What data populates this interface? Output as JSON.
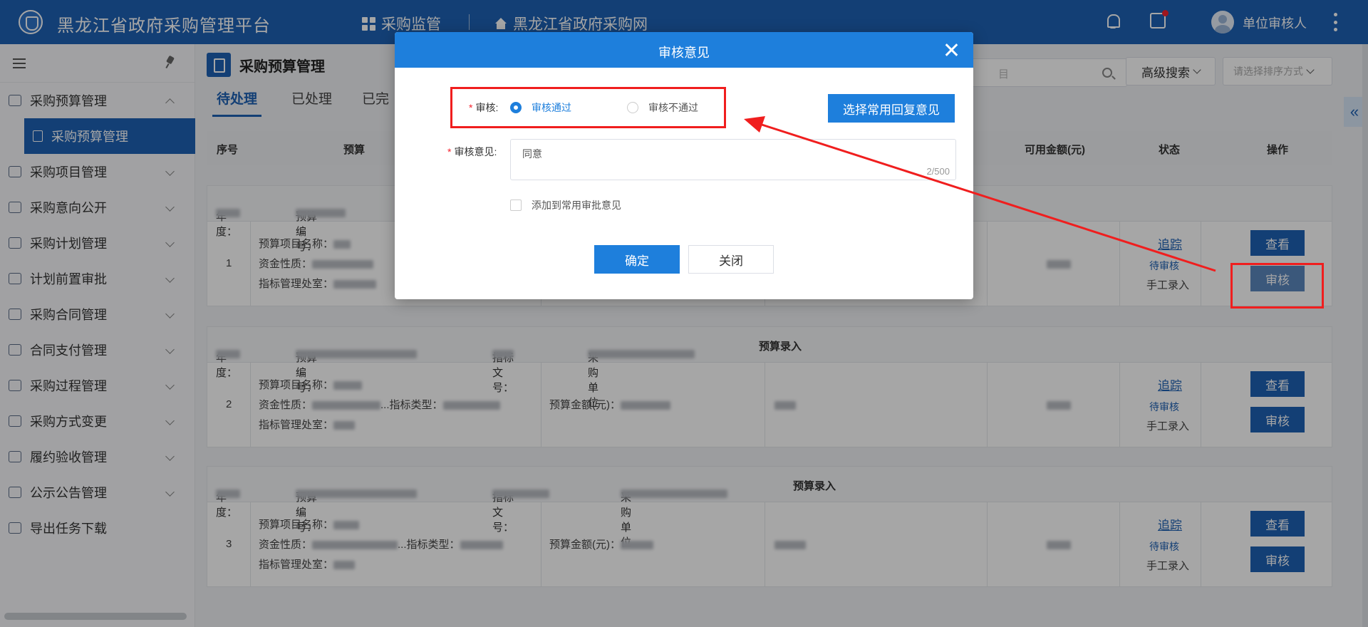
{
  "header": {
    "app_title": "黑龙江省政府采购管理平台",
    "nav_items": [
      "采购监管",
      "黑龙江省政府采购网"
    ],
    "user_name": "单位审核人"
  },
  "sidebar": {
    "items": [
      {
        "label": "采购预算管理",
        "expanded": true
      },
      {
        "label": "采购预算管理",
        "sub": true,
        "active": true
      },
      {
        "label": "采购项目管理"
      },
      {
        "label": "采购意向公开"
      },
      {
        "label": "采购计划管理"
      },
      {
        "label": "计划前置审批"
      },
      {
        "label": "采购合同管理"
      },
      {
        "label": "合同支付管理"
      },
      {
        "label": "采购过程管理"
      },
      {
        "label": "采购方式变更"
      },
      {
        "label": "履约验收管理"
      },
      {
        "label": "公示公告管理"
      },
      {
        "label": "导出任务下载"
      }
    ]
  },
  "page": {
    "title": "采购预算管理",
    "tabs": [
      "待处理",
      "已处理",
      "已完"
    ],
    "search_placeholder": "目",
    "advanced_search": "高级搜索",
    "sort_placeholder": "请选择排序方式"
  },
  "table": {
    "headers": [
      "序号",
      "预算",
      "可用金额(元)",
      "状态",
      "操作"
    ],
    "group_labels": {
      "year": "年度：",
      "budget_no": "预算编号：",
      "index_doc": "指标文号：",
      "purchase_unit": "采购单位",
      "budget_entry": "预算录入"
    },
    "row_labels": {
      "project_name": "预算项目名称：",
      "fund_nature": "资金性质：",
      "index_type": "...指标类型：",
      "index_office": "指标管理处室：",
      "budget_amount": "预算金额(元)："
    },
    "rows": [
      {
        "seq": "1",
        "track": "追踪",
        "status": "待审核",
        "entry": "手工录入",
        "view": "查看",
        "audit": "审核"
      },
      {
        "seq": "2",
        "track": "追踪",
        "status": "待审核",
        "entry": "手工录入",
        "view": "查看",
        "audit": "审核"
      },
      {
        "seq": "3",
        "track": "追踪",
        "status": "待审核",
        "entry": "手工录入",
        "view": "查看",
        "audit": "审核"
      }
    ]
  },
  "modal": {
    "title": "审核意见",
    "audit_label": "审核:",
    "option_pass": "审核通过",
    "option_fail": "审核不通过",
    "reply_button": "选择常用回复意见",
    "opinion_label": "审核意见:",
    "opinion_value": "同意",
    "opinion_count": "2/500",
    "add_common": "添加到常用审批意见",
    "confirm": "确定",
    "close": "关闭"
  },
  "colors": {
    "header_bg": "#1e61b4",
    "modal_header_bg": "#1e7fdc",
    "highlight": "#f01e1e"
  }
}
